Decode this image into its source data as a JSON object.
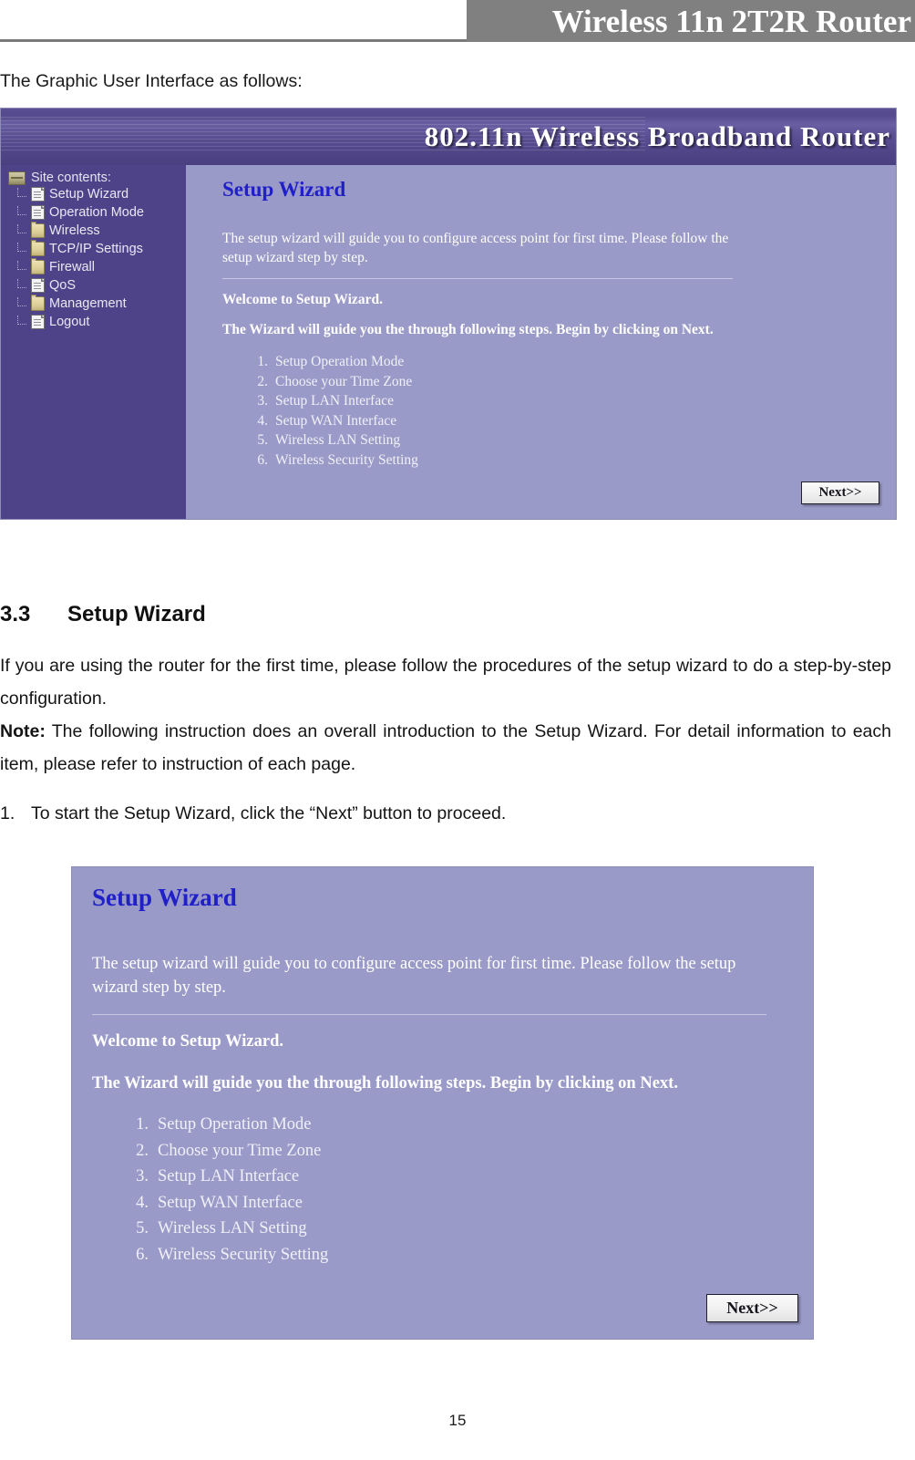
{
  "header": {
    "running_title": "Wireless 11n 2T2R Router"
  },
  "intro": {
    "text": "The Graphic User Interface as follows:"
  },
  "router_ui": {
    "banner_title": "802.11n   Wireless  Broadband  Router",
    "sidebar": {
      "root_label": "Site contents:",
      "root_icon": "book-icon",
      "items": [
        {
          "label": "Setup Wizard",
          "icon": "page-icon"
        },
        {
          "label": "Operation Mode",
          "icon": "page-icon"
        },
        {
          "label": "Wireless",
          "icon": "folder-icon"
        },
        {
          "label": "TCP/IP Settings",
          "icon": "folder-icon"
        },
        {
          "label": "Firewall",
          "icon": "folder-icon"
        },
        {
          "label": "QoS",
          "icon": "page-icon"
        },
        {
          "label": "Management",
          "icon": "folder-icon"
        },
        {
          "label": "Logout",
          "icon": "page-icon"
        }
      ]
    },
    "panel": {
      "title": "Setup Wizard",
      "description": "The setup wizard will guide you to configure access point for first time. Please follow the setup wizard step by step.",
      "welcome": "Welcome to Setup Wizard.",
      "instruction": "The Wizard will guide you the through following steps. Begin by clicking on Next.",
      "steps": [
        {
          "num": "1.",
          "label": "Setup Operation Mode"
        },
        {
          "num": "2.",
          "label": "Choose your Time Zone"
        },
        {
          "num": "3.",
          "label": "Setup LAN Interface"
        },
        {
          "num": "4.",
          "label": "Setup WAN Interface"
        },
        {
          "num": "5.",
          "label": "Wireless LAN Setting"
        },
        {
          "num": "6.",
          "label": "Wireless Security Setting"
        }
      ],
      "next_button": "Next>>"
    }
  },
  "section": {
    "number": "3.3",
    "title": "Setup Wizard",
    "paragraph1": "If you are using the router for the first time, please follow the procedures of the setup wizard to do a step-by-step configuration.",
    "note_label": "Note:",
    "note_text": " The following instruction does an overall introduction to the Setup Wizard. For detail information to each item, please refer to instruction of each page.",
    "step_number": "1.",
    "step_text": "To start the Setup Wizard, click the “Next” button to proceed."
  },
  "footer": {
    "page_number": "15"
  },
  "colors": {
    "header_badge_bg": "#808080",
    "banner_purple": "#554a8e",
    "sidebar_purple": "#4e4388",
    "content_purple": "#9a9ac8",
    "panel_title_blue": "#2020c8",
    "folder_tan": "#ddd09a"
  }
}
